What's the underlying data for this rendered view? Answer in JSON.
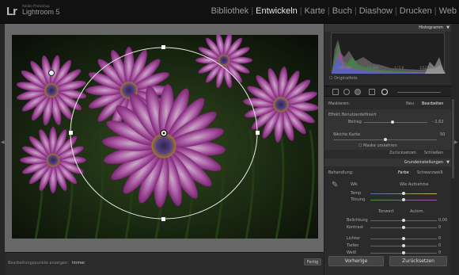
{
  "app": {
    "logo": "Lr",
    "vendor": "Adobe Photoshop",
    "product": "Lightroom 5"
  },
  "modules": [
    {
      "label": "Bibliothek",
      "active": false
    },
    {
      "label": "Entwickeln",
      "active": true
    },
    {
      "label": "Karte",
      "active": false
    },
    {
      "label": "Buch",
      "active": false
    },
    {
      "label": "Diashow",
      "active": false
    },
    {
      "label": "Drucken",
      "active": false
    },
    {
      "label": "Web",
      "active": false
    }
  ],
  "toolbar": {
    "overlay_label": "Bearbeitungspunkte anzeigen:",
    "overlay_value": "Immer",
    "done_label": "Fertig"
  },
  "histogram": {
    "title": "Histogramm",
    "info": [
      "ISO 100",
      "55 mm",
      "f / 5.6",
      "1/125 Sek."
    ],
    "original_label": "Originalfoto"
  },
  "mask": {
    "title": "Maskieren:",
    "new_label": "Neu",
    "edit_label": "Bearbeiten"
  },
  "effect": {
    "title": "Effekt:",
    "preset": "Benutzerdefiniert",
    "amount_label": "Betrag",
    "amount_value": "- 2,62",
    "amount_frac": 0.45
  },
  "feather": {
    "label": "Weiche Kante",
    "value": "50",
    "frac": 0.5
  },
  "invert_label": "Maske umkehren",
  "reset_label": "Zurücksetzen",
  "close_label": "Schließen",
  "basics": {
    "title": "Grundeinstellungen",
    "treatment_label": "Behandlung:",
    "color_label": "Farbe",
    "bw_label": "Schwarzweiß",
    "wb_label": "WA:",
    "wb_value": "Wie Aufnahme",
    "temp_label": "Temp",
    "tint_label": "Tönung",
    "tone_label": "Tonwert",
    "auto_label": "Autom.",
    "sliders": [
      {
        "label": "Belichtung",
        "value": "0,00"
      },
      {
        "label": "Kontrast",
        "value": "0"
      },
      {
        "label": "Lichter",
        "value": "0"
      },
      {
        "label": "Tiefen",
        "value": "0"
      },
      {
        "label": "Weiß",
        "value": "0"
      }
    ]
  },
  "actions": {
    "previous_label": "Vorherige",
    "reset_label": "Zurücksetzen"
  }
}
